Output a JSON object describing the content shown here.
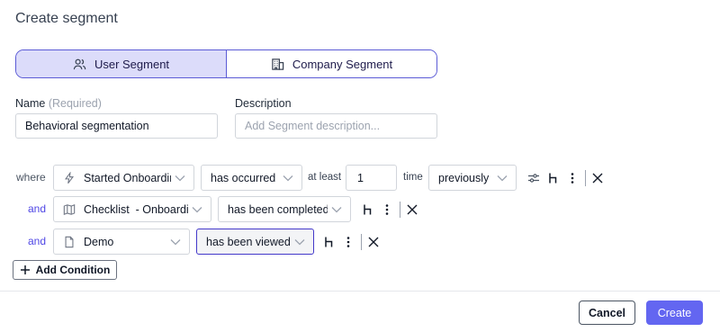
{
  "dialog": {
    "title": "Create segment"
  },
  "segment_type": {
    "user_label": "User Segment",
    "company_label": "Company Segment",
    "selected": "User Segment"
  },
  "name": {
    "label": "Name",
    "required_hint": "(Required)",
    "value": "Behavioral segmentation"
  },
  "description": {
    "label": "Description",
    "placeholder": "Add Segment description..."
  },
  "conditions": [
    {
      "conjunction": "where",
      "field": "Started Onboarding",
      "field_icon": "lightning-icon",
      "operator": "has occurred",
      "qualifier": "at least",
      "count": "1",
      "unit": "time",
      "timeframe": "previously"
    },
    {
      "conjunction": "and",
      "field": "Checklist  - Onboarding",
      "field_icon": "map-icon",
      "operator": "has been completed"
    },
    {
      "conjunction": "and",
      "field": "Demo",
      "field_icon": "document-icon",
      "operator": "has been viewed"
    }
  ],
  "add_condition_label": "Add Condition",
  "footer": {
    "cancel_label": "Cancel",
    "create_label": "Create"
  },
  "colors": {
    "accent": "#6366f1",
    "toggle_active_bg": "#dcdcfa",
    "and_text": "#4f46e5"
  }
}
